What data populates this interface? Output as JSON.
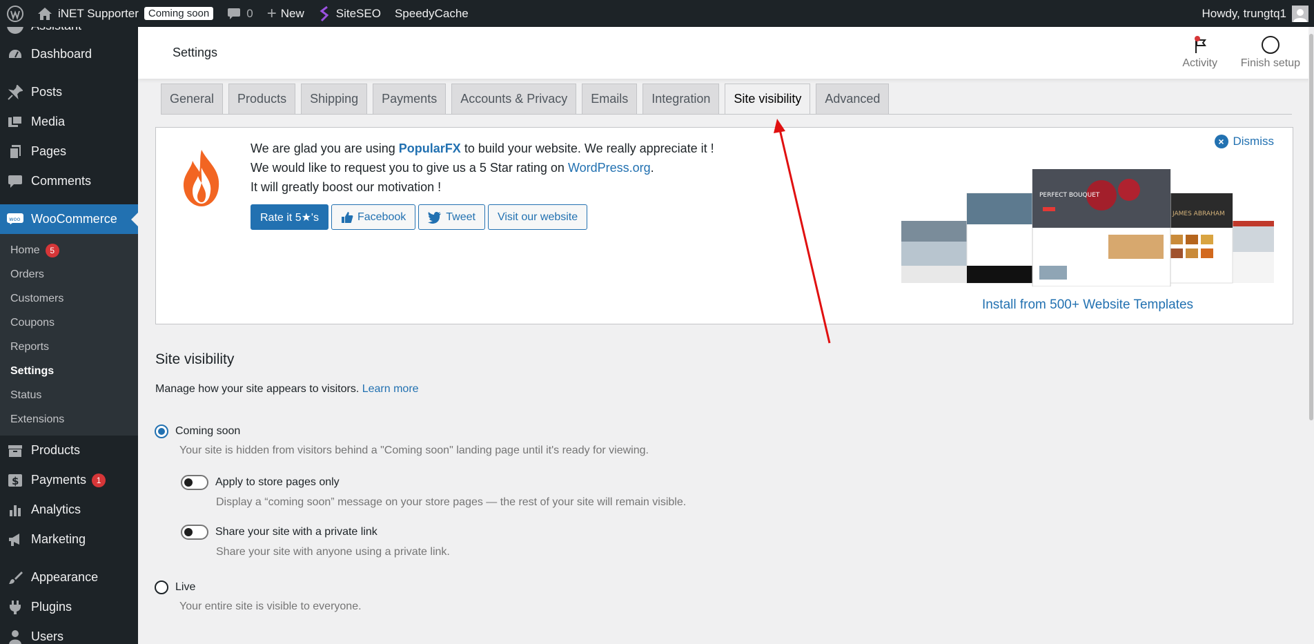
{
  "adminbar": {
    "site_name": "iNET Supporter",
    "coming_soon_badge": "Coming soon",
    "comments_count": "0",
    "new_label": "New",
    "siteseo_label": "SiteSEO",
    "speedycache_label": "SpeedyCache",
    "howdy": "Howdy, trungtq1"
  },
  "sidebar": {
    "partial_top_label": "Assistant",
    "items": [
      {
        "label": "Dashboard",
        "icon": "dashboard-icon"
      },
      {
        "label": "Posts",
        "icon": "pin-icon"
      },
      {
        "label": "Media",
        "icon": "media-icon"
      },
      {
        "label": "Pages",
        "icon": "pages-icon"
      },
      {
        "label": "Comments",
        "icon": "comment-icon"
      },
      {
        "label": "WooCommerce",
        "icon": "woo-icon"
      }
    ],
    "woo_submenu": [
      {
        "label": "Home",
        "badge": "5"
      },
      {
        "label": "Orders"
      },
      {
        "label": "Customers"
      },
      {
        "label": "Coupons"
      },
      {
        "label": "Reports"
      },
      {
        "label": "Settings"
      },
      {
        "label": "Status"
      },
      {
        "label": "Extensions"
      }
    ],
    "items_after": [
      {
        "label": "Products",
        "icon": "archive-icon"
      },
      {
        "label": "Payments",
        "icon": "dollar-icon",
        "badge": "1"
      },
      {
        "label": "Analytics",
        "icon": "bar-chart-icon"
      },
      {
        "label": "Marketing",
        "icon": "megaphone-icon"
      },
      {
        "label": "Appearance",
        "icon": "brush-icon"
      },
      {
        "label": "Plugins",
        "icon": "plug-icon"
      },
      {
        "label": "Users",
        "icon": "users-icon"
      }
    ]
  },
  "header": {
    "title": "Settings",
    "activity_label": "Activity",
    "finish_setup_label": "Finish setup"
  },
  "tabs": [
    "General",
    "Products",
    "Shipping",
    "Payments",
    "Accounts & Privacy",
    "Emails",
    "Integration",
    "Site visibility",
    "Advanced"
  ],
  "notice": {
    "line1_pre": "We are glad you are using ",
    "line1_link": "PopularFX",
    "line1_post": " to build your website. We really appreciate it !",
    "line2_pre": "We would like to request you to give us a 5 Star rating on ",
    "line2_link": "WordPress.org",
    "line2_post": ".",
    "line3": "It will greatly boost our motivation !",
    "rate_button": "Rate it 5★'s",
    "facebook_button": "Facebook",
    "tweet_button": "Tweet",
    "visit_button": "Visit our website",
    "dismiss": "Dismiss",
    "install_link": "Install from 500+ Website Templates"
  },
  "site_visibility": {
    "title": "Site visibility",
    "description": "Manage how your site appears to visitors.",
    "learn_more": "Learn more",
    "coming_soon_label": "Coming soon",
    "coming_soon_help": "Your site is hidden from visitors behind a \"Coming soon\" landing page until it's ready for viewing.",
    "store_only_label": "Apply to store pages only",
    "store_only_help": "Display a “coming soon” message on your store pages — the rest of your site will remain visible.",
    "private_link_label": "Share your site with a private link",
    "private_link_help": "Share your site with anyone using a private link.",
    "live_label": "Live",
    "live_help": "Your entire site is visible to everyone."
  },
  "colors": {
    "admin_dark": "#1d2327",
    "accent_blue": "#2271b1",
    "badge_red": "#d63638",
    "annotation_red": "#e01010"
  }
}
